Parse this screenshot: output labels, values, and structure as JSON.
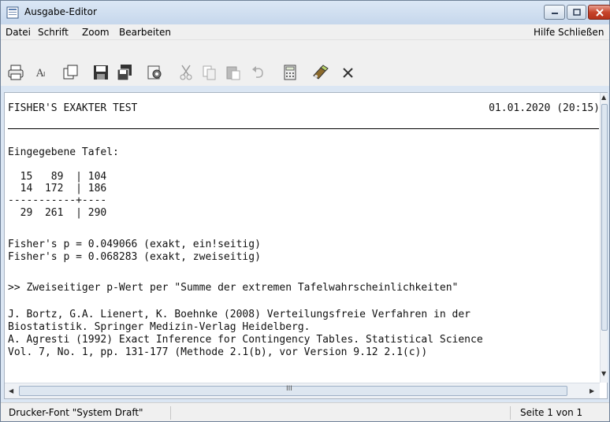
{
  "window": {
    "title": "Ausgabe-Editor"
  },
  "menu": {
    "left": [
      "Datei",
      "Schrift",
      "Zoom",
      "Bearbeiten"
    ],
    "right": [
      "Hilfe",
      "Schließen"
    ]
  },
  "toolbar": {
    "icons": [
      "printer-icon",
      "font-icon",
      "copy-window-icon",
      "save-icon",
      "save-all-icon",
      "settings-icon",
      "cut-icon",
      "copy-icon",
      "paste-icon",
      "undo-icon",
      "calculator-icon",
      "edit-icon",
      "close-x-icon"
    ]
  },
  "document": {
    "heading": "FISHER'S EXAKTER TEST",
    "date": "01.01.2020 (20:15)",
    "lines": [
      "Eingegebene Tafel:",
      "  15   89  | 104",
      "  14  172  | 186",
      "-----------+----",
      "  29  261  | 290",
      "Fisher's p = 0.049066 (exakt, ein!seitig)",
      "Fisher's p = 0.068283 (exakt, zweiseitig)",
      ">> Zweiseitiger p-Wert per \"Summe der extremen Tafelwahrscheinlichkeiten\"",
      "J. Bortz, G.A. Lienert, K. Boehnke (2008) Verteilungsfreie Verfahren in der",
      "Biostatistik. Springer Medizin-Verlag Heidelberg.",
      "A. Agresti (1992) Exact Inference for Contingency Tables. Statistical Science",
      "Vol. 7, No. 1, pp. 131-177 (Methode 2.1(b), vor Version 9.12 2.1(c))"
    ]
  },
  "scroll": {
    "h_thumb_grip": "III"
  },
  "status": {
    "font": "Drucker-Font \"System Draft\"",
    "page": "Seite 1 von 1"
  }
}
